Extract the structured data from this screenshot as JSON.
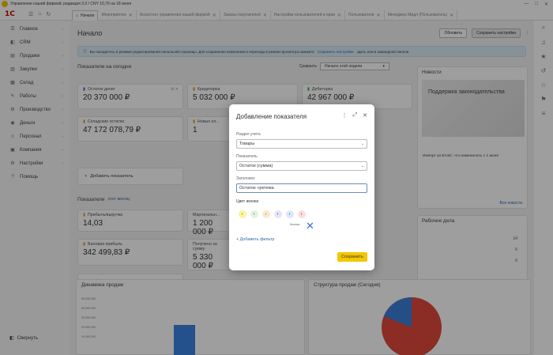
{
  "window": {
    "title": "Управление нашей фирмой, редакция 3.0 / CNY 10,76 на 18 июня",
    "controls": [
      "—",
      "□",
      "✕"
    ]
  },
  "topbar": {
    "logo": "1С",
    "icons": [
      "☰",
      "⌂",
      "↻"
    ],
    "tabs": [
      {
        "label": "Начало",
        "active": true
      },
      {
        "label": "Мероприятия",
        "active": false
      },
      {
        "label": "Ассистент управления нашей фирмой",
        "active": false
      },
      {
        "label": "Заказы покупателей",
        "active": false
      },
      {
        "label": "Настройки пользователей и прав",
        "active": false
      },
      {
        "label": "Пользователи",
        "active": false
      },
      {
        "label": "Менеджер Мидл (Пользователь)",
        "active": false
      }
    ]
  },
  "sidebar": {
    "items": [
      {
        "label": "Главное",
        "icon": "☰"
      },
      {
        "label": "CRM",
        "icon": "◧"
      },
      {
        "label": "Продажи",
        "icon": "▤"
      },
      {
        "label": "Закупки",
        "icon": "▥"
      },
      {
        "label": "Склад",
        "icon": "▦"
      },
      {
        "label": "Работы",
        "icon": "✎"
      },
      {
        "label": "Производство",
        "icon": "⚙"
      },
      {
        "label": "Деньги",
        "icon": "◉"
      },
      {
        "label": "Персонал",
        "icon": "☺"
      },
      {
        "label": "Компания",
        "icon": "▣"
      },
      {
        "label": "Настройки",
        "icon": "⚙"
      },
      {
        "label": "Помощь",
        "icon": "?"
      }
    ],
    "collapse_label": "Свернуть"
  },
  "rightbar": {
    "icons": [
      "⌕",
      "♫",
      "★",
      "↺",
      "☆",
      "⚑",
      "≡"
    ]
  },
  "main": {
    "title": "Начало",
    "refresh": "Обновить",
    "save_settings": "Сохранить настройки",
    "info": {
      "text": "Вы находитесь в режиме редактирования начальной страницы. Для сохранения изменения и перехода в режим просмотра нажмите",
      "link": "Сохранить настройки",
      "tail": "здесь или в командной панели"
    },
    "today": {
      "title": "Показатели на сегодня",
      "compare_label": "Сравнить",
      "compare_value": "Начало этой недели"
    },
    "cards_row1": [
      {
        "label": "Остаток денег",
        "value": "20 370 000 ₽",
        "icon": "▮"
      },
      {
        "label": "Кредиторка",
        "value": "5 032 000 ₽",
        "icon": "▮"
      },
      {
        "label": "Дебиторка",
        "value": "42 967 000 ₽",
        "icon": "▮"
      }
    ],
    "cards_row2": [
      {
        "label": "Складские остатки",
        "value": "47 172 078,79 ₽",
        "icon": "▮"
      },
      {
        "label": "Новые кл...",
        "value": "1",
        "icon": "▮"
      }
    ],
    "add_indicator": "Добавить показатель",
    "period": {
      "title": "Показатели",
      "link": "этот месяц"
    },
    "cards_row3": [
      {
        "label": "Прибыль/выручка",
        "value": "14,03"
      },
      {
        "label": "Маргинальн...",
        "value": "1 200 000 ₽"
      }
    ],
    "cards_row4": [
      {
        "label": "Валовая прибыль",
        "value": "342 499,83 ₽"
      },
      {
        "label": "Получено за сумму",
        "value": "5 330 000 ₽"
      }
    ],
    "news": {
      "title": "Новости",
      "headline": "Поддержка законодательства",
      "snippet": "Импорт из ЕАЭС: что изменилось с 1 июня",
      "all_news": "Все новости"
    },
    "sales_dynamic": {
      "title": "Динамика продаж",
      "ticks": [
        "50 000 000",
        "40 000 000",
        "30 000 000",
        "20 000 000",
        "10 000 000"
      ]
    },
    "sales_structure": {
      "title": "Структура продаж (Сегодня)"
    },
    "reports": {
      "title": "Рабочие дела",
      "counts": [
        "14",
        "6",
        "6"
      ]
    }
  },
  "dialog": {
    "title": "Добавление показателя",
    "section_label": "Раздел учета",
    "section_value": "Товары",
    "indicator_label": "Показатель",
    "indicator_value": "Остаток (сумма)",
    "header_label": "Заголовок",
    "header_value": "Остаток «ретежа",
    "color_label": "Цвет иконки",
    "colors": [
      "#f2e14c",
      "#79c36a",
      "#f0a640",
      "#8a6fd1",
      "#5d8fd8",
      "#e36b6b"
    ],
    "mini_label": "Кнопка",
    "add_filter": "+ Добавить фильтр",
    "save": "Сохранить",
    "icons": {
      "more": "⋮",
      "expand": "⤢",
      "close": "✕"
    }
  }
}
